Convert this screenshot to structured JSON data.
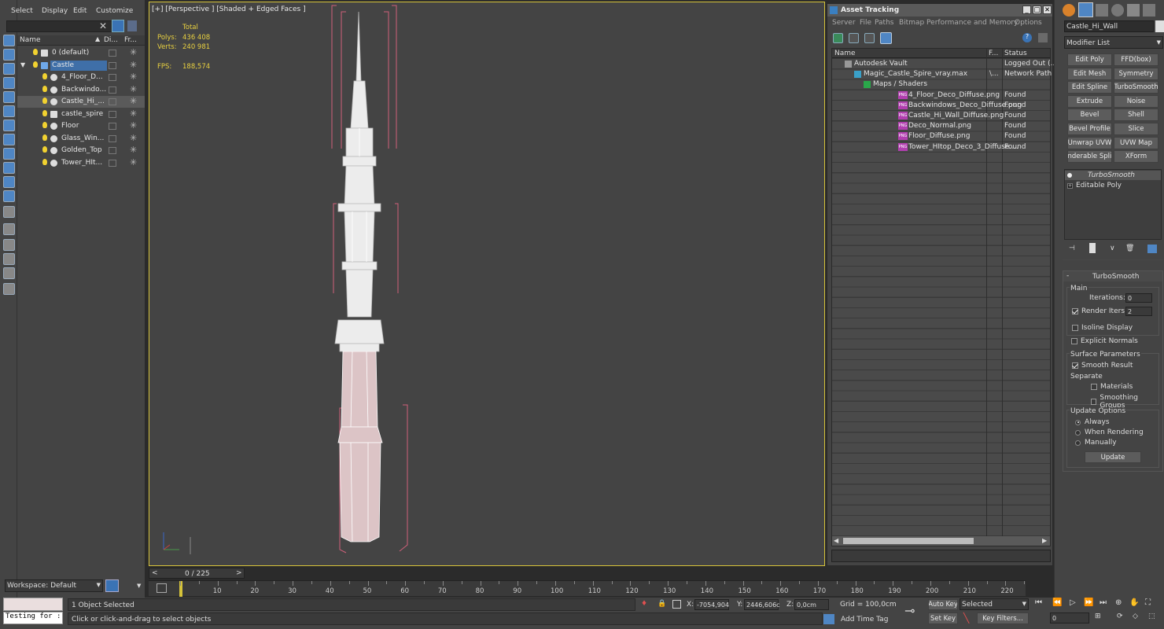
{
  "scene_explorer": {
    "menu": [
      "Select",
      "Display",
      "Edit",
      "Customize"
    ],
    "columns": {
      "name": "Name",
      "display": "Di...",
      "freeze": "Fr..."
    },
    "rows": [
      {
        "label": "0 (default)",
        "type": "layer",
        "selected": false
      },
      {
        "label": "Castle",
        "type": "layer",
        "selected": true
      },
      {
        "label": "4_Floor_D...",
        "type": "object",
        "selected": false
      },
      {
        "label": "Backwindo...",
        "type": "object",
        "selected": false
      },
      {
        "label": "Castle_Hi_...",
        "type": "object",
        "selected": false
      },
      {
        "label": "castle_spire",
        "type": "group",
        "selected": false
      },
      {
        "label": "Floor",
        "type": "object",
        "selected": false
      },
      {
        "label": "Glass_Win...",
        "type": "object",
        "selected": false
      },
      {
        "label": "Golden_Top",
        "type": "object",
        "selected": false
      },
      {
        "label": "Tower_HIt...",
        "type": "object",
        "selected": false
      }
    ],
    "workspace": "Workspace: Default"
  },
  "viewport": {
    "label": "[+] [Perspective ] [Shaded + Edged Faces ]",
    "stats": {
      "total_label": "Total",
      "polys_label": "Polys:",
      "polys": "436 408",
      "verts_label": "Verts:",
      "verts": "240 981",
      "fps_label": "FPS:",
      "fps": "188,574"
    }
  },
  "asset_tracking": {
    "title": "Asset Tracking",
    "menu": [
      "Server",
      "File",
      "Paths",
      "Bitmap Performance and Memory",
      "Options"
    ],
    "columns": {
      "name": "Name",
      "full": "F...",
      "status": "Status"
    },
    "rows": [
      {
        "name": "Autodesk Vault",
        "full": "",
        "status": "Logged Out (...",
        "kind": "vault",
        "indent": 1
      },
      {
        "name": "Magic_Castle_Spire_vray.max",
        "full": "\\...",
        "status": "Network Path",
        "kind": "max",
        "indent": 2
      },
      {
        "name": "Maps / Shaders",
        "full": "",
        "status": "",
        "kind": "maps",
        "indent": 3
      },
      {
        "name": "4_Floor_Deco_Diffuse.png",
        "full": "",
        "status": "Found",
        "kind": "png",
        "indent": 4
      },
      {
        "name": "Backwindows_Deco_Diffuse.png",
        "full": "",
        "status": "Found",
        "kind": "png",
        "indent": 4
      },
      {
        "name": "Castle_Hi_Wall_Diffuse.png",
        "full": "",
        "status": "Found",
        "kind": "png",
        "indent": 4
      },
      {
        "name": "Deco_Normal.png",
        "full": "",
        "status": "Found",
        "kind": "png",
        "indent": 4
      },
      {
        "name": "Floor_Diffuse.png",
        "full": "",
        "status": "Found",
        "kind": "png",
        "indent": 4
      },
      {
        "name": "Tower_HItop_Deco_3_Diffuse....",
        "full": "",
        "status": "Found",
        "kind": "png",
        "indent": 4
      }
    ],
    "png_tag": "PNG"
  },
  "command_panel": {
    "object_name": "Castle_Hi_Wall",
    "modifier_list": "Modifier List",
    "modifier_buttons": [
      "Edit Poly",
      "FFD(box)",
      "Edit Mesh",
      "Symmetry",
      "Edit Spline",
      "TurboSmooth",
      "Extrude",
      "Noise",
      "Bevel",
      "Shell",
      "Bevel Profile",
      "Slice",
      "Unwrap UVW",
      "UVW Map",
      "enderable Splin",
      "XForm"
    ],
    "stack": [
      "TurboSmooth",
      "Editable Poly"
    ],
    "rollout": {
      "title": "TurboSmooth",
      "main": "Main",
      "iterations_label": "Iterations:",
      "iterations": "0",
      "render_iters_label": "Render Iters:",
      "render_iters": "2",
      "isoline": "Isoline Display",
      "explicit": "Explicit Normals",
      "surface": "Surface Parameters",
      "smooth": "Smooth Result",
      "separate": "Separate",
      "materials": "Materials",
      "smoothing": "Smoothing Groups",
      "update_options": "Update Options",
      "always": "Always",
      "when_rendering": "When Rendering",
      "manually": "Manually",
      "update_button": "Update"
    }
  },
  "timeline": {
    "frame_counter": "0 / 225",
    "ticks": [
      "10",
      "20",
      "30",
      "40",
      "50",
      "60",
      "70",
      "80",
      "90",
      "100",
      "110",
      "120",
      "130",
      "140",
      "150",
      "160",
      "170",
      "180",
      "190",
      "200",
      "210",
      "220"
    ]
  },
  "status": {
    "script_label": "Testing for :",
    "selected": "1 Object Selected",
    "prompt": "Click or click-and-drag to select objects",
    "x_label": "X:",
    "x": "-7054,904",
    "y_label": "Y:",
    "y": "2446,606c",
    "z_label": "Z:",
    "z": "0,0cm",
    "grid": "Grid = 100,0cm",
    "add_time_tag": "Add Time Tag",
    "auto_key": "Auto Key",
    "selected_set": "Selected",
    "set_key": "Set Key",
    "key_filters": "Key Filters...",
    "frame": "0"
  },
  "colors": {
    "accent": "#5d7fa3",
    "selection": "#3f6fa8",
    "found_status": "#e0e0e0",
    "highlight": "#e8d040"
  }
}
